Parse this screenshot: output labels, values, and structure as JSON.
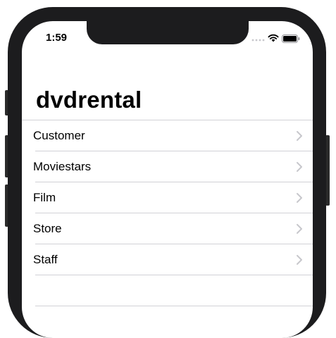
{
  "status_bar": {
    "time": "1:59",
    "icons": [
      "cellular-signal-icon",
      "wifi-icon",
      "battery-icon"
    ]
  },
  "nav": {
    "title": "dvdrental"
  },
  "list": {
    "items": [
      {
        "label": "Customer",
        "icon": "chevron-right-icon"
      },
      {
        "label": "Moviestars",
        "icon": "chevron-right-icon"
      },
      {
        "label": "Film",
        "icon": "chevron-right-icon"
      },
      {
        "label": "Store",
        "icon": "chevron-right-icon"
      },
      {
        "label": "Staff",
        "icon": "chevron-right-icon"
      }
    ]
  },
  "colors": {
    "device_frame": "#1c1c1e",
    "separator": "#d1d1d6",
    "chevron": "#c7c7cc",
    "text": "#000000"
  }
}
